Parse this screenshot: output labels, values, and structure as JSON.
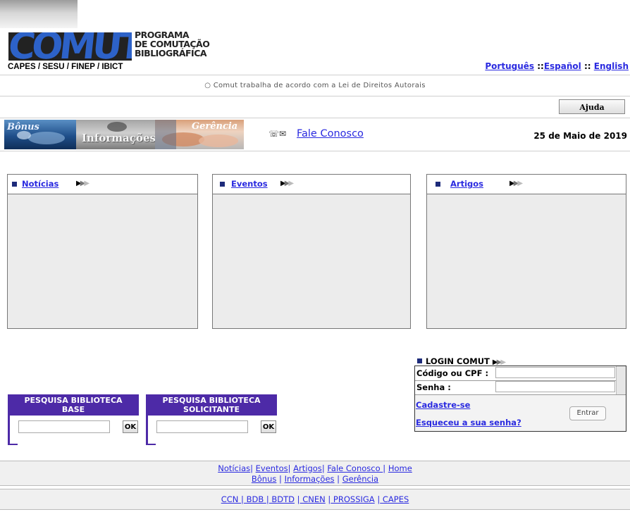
{
  "header": {
    "logo_word": "COMUT",
    "logo_subtitle": [
      "PROGRAMA",
      "DE COMUTAÇÃO",
      "BIBLIOGRÁFICA"
    ],
    "partners": "CAPES / SESU / FINEP / IBICT",
    "languages": [
      "Português",
      "Español",
      "English"
    ],
    "language_separator": "::"
  },
  "notice": "○ Comut trabalha de acordo com a Lei de Direitos Autorais",
  "help_button": "Ajuda",
  "banner": {
    "tiles": [
      "Bônus",
      "Informações",
      "Gerência"
    ],
    "contact_icon": "envelope-phone-icon",
    "contact_glyph": "☏✉",
    "contact_label": "Fale Conosco",
    "date": "25 de Maio de 2019"
  },
  "panels": [
    {
      "title": "Notícias"
    },
    {
      "title": "Eventos"
    },
    {
      "title": "Artigos"
    }
  ],
  "arrow_glyph": "▶▶▶",
  "login": {
    "title": "LOGIN COMUT",
    "code_label": "Código ou CPF :",
    "code_value": "",
    "password_label": "Senha :",
    "password_value": "",
    "signup": "Cadastre-se",
    "forgot": "Esqueceu a sua senha?",
    "enter": "Entrar"
  },
  "search": [
    {
      "title_line1": "PESQUISA BIBLIOTECA",
      "title_line2": "BASE",
      "value": "",
      "button": "OK"
    },
    {
      "title_line1": "PESQUISA BIBLIOTECA",
      "title_line2": "SOLICITANTE",
      "value": "",
      "button": "OK"
    }
  ],
  "footer": {
    "row1": [
      "Notícias",
      "Eventos",
      "Artigos",
      "Fale Conosco ",
      "Home"
    ],
    "row2": [
      "Bônus",
      "Informações",
      "Gerência"
    ],
    "row3": [
      "CCN ",
      " BDB ",
      " BDTD",
      " CNEN",
      " PROSSIGA",
      " CAPES"
    ]
  },
  "colors": {
    "link": "#2a2ae0",
    "search_header": "#4d2aa7",
    "logo_blue": "#2d62c8",
    "bullet": "#1d2b7a"
  }
}
